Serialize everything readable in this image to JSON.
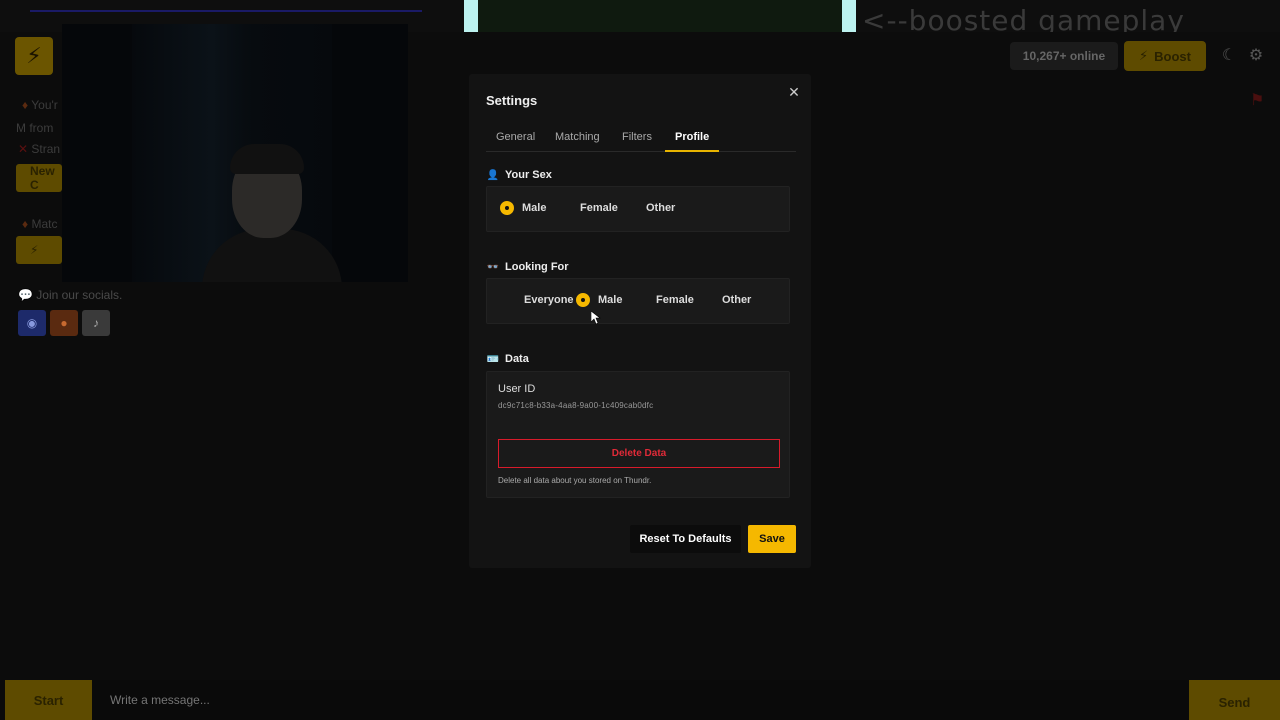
{
  "overlay": {
    "caption": "<--boosted gameplay"
  },
  "header": {
    "online_count": "10,267+ online",
    "boost_label": "Boost"
  },
  "sidebar": {
    "line1": "You'r",
    "line2": "M from",
    "line3": "Stran",
    "new_button": "New C",
    "line4": "Matc",
    "socials_label": "Join our socials."
  },
  "bottom": {
    "start_label": "Start",
    "message_placeholder": "Write a message...",
    "send_label": "Send"
  },
  "settings": {
    "title": "Settings",
    "tabs": [
      {
        "label": "General"
      },
      {
        "label": "Matching"
      },
      {
        "label": "Filters"
      },
      {
        "label": "Profile"
      }
    ],
    "active_tab": "Profile",
    "your_sex": {
      "title": "Your Sex",
      "options": [
        "Male",
        "Female",
        "Other"
      ],
      "selected": "Male"
    },
    "looking_for": {
      "title": "Looking For",
      "options": [
        "Everyone",
        "Male",
        "Female",
        "Other"
      ],
      "selected": "Male"
    },
    "data": {
      "title": "Data",
      "user_id_label": "User ID",
      "user_id_value": "dc9c71c8-b33a-4aa8-9a00-1c409cab0dfc",
      "delete_label": "Delete Data",
      "delete_note": "Delete all data about you stored on Thundr."
    },
    "reset_label": "Reset To Defaults",
    "save_label": "Save"
  },
  "colors": {
    "accent": "#f5b800",
    "danger": "#e02a38",
    "modal_bg": "#131313"
  }
}
